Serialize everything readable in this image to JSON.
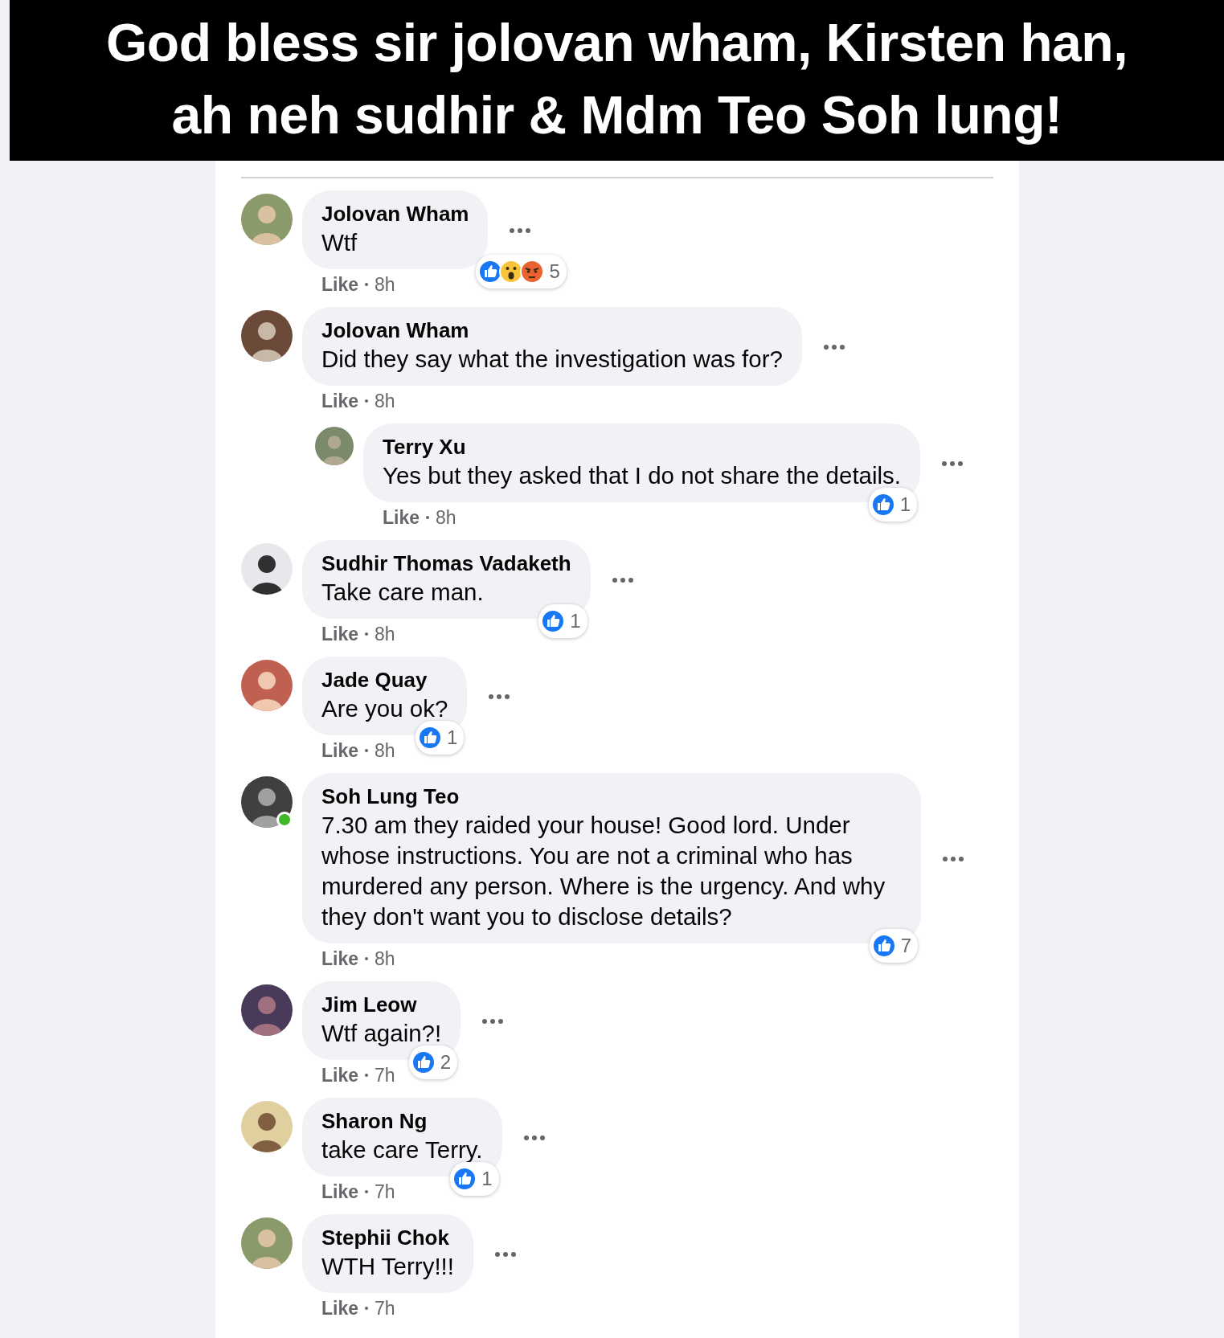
{
  "caption": {
    "lines": [
      "God bless sir jolovan wham, Kirsten han,",
      "ah neh sudhir & Mdm Teo Soh lung!"
    ]
  },
  "comments": [
    {
      "author": "Jolovan Wham",
      "text": "Wtf",
      "like": "Like",
      "time": "8h",
      "reactions": [
        {
          "kind": "like"
        },
        {
          "kind": "wow"
        },
        {
          "kind": "angry"
        }
      ],
      "reaction_count": "5",
      "online": false
    },
    {
      "author": "Jolovan Wham",
      "text": "Did they say what the investigation was for?",
      "like": "Like",
      "time": "8h",
      "online": false,
      "replies": [
        {
          "author": "Terry Xu",
          "text": "Yes but they asked that I do not share the details.",
          "like": "Like",
          "time": "8h",
          "reactions": [
            {
              "kind": "like"
            }
          ],
          "reaction_count": "1",
          "online": false
        }
      ]
    },
    {
      "author": "Sudhir Thomas Vadaketh",
      "text": "Take care man.",
      "like": "Like",
      "time": "8h",
      "reactions": [
        {
          "kind": "like"
        }
      ],
      "reaction_count": "1",
      "online": false
    },
    {
      "author": "Jade Quay",
      "text": "Are you ok?",
      "like": "Like",
      "time": "8h",
      "reactions": [
        {
          "kind": "like"
        }
      ],
      "reaction_count": "1",
      "online": false
    },
    {
      "author": "Soh Lung Teo",
      "text": "7.30 am they raided your house! Good lord. Under whose instructions. You are not a criminal who has murdered any person. Where is the urgency. And why they don't want you to disclose details?",
      "like": "Like",
      "time": "8h",
      "reactions": [
        {
          "kind": "like"
        }
      ],
      "reaction_count": "7",
      "online": true
    },
    {
      "author": "Jim Leow",
      "text": "Wtf again?!",
      "like": "Like",
      "time": "7h",
      "reactions": [
        {
          "kind": "like"
        }
      ],
      "reaction_count": "2",
      "online": false
    },
    {
      "author": "Sharon Ng",
      "text": "take care Terry.",
      "like": "Like",
      "time": "7h",
      "reactions": [
        {
          "kind": "like"
        }
      ],
      "reaction_count": "1",
      "online": false
    },
    {
      "author": "Stephii Chok",
      "text": "WTH Terry!!!",
      "like": "Like",
      "time": "7h",
      "online": false
    }
  ]
}
